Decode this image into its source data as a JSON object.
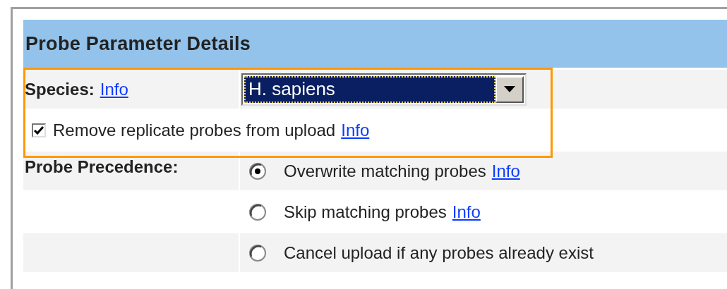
{
  "panel": {
    "title": "Probe Parameter Details"
  },
  "highlighted_group": true,
  "species": {
    "label": "Species:",
    "info_link": "Info",
    "value": "H. sapiens"
  },
  "remove_replicates": {
    "label": "Remove replicate probes from upload",
    "checked": true,
    "info_link": "Info"
  },
  "probe_precedence": {
    "label": "Probe Precedence:",
    "options": [
      {
        "label": "Overwrite matching probes",
        "info_link": "Info",
        "selected": true
      },
      {
        "label": "Skip matching probes",
        "info_link": "Info",
        "selected": false
      },
      {
        "label": "Cancel upload if any probes already exist",
        "selected": false
      }
    ]
  }
}
